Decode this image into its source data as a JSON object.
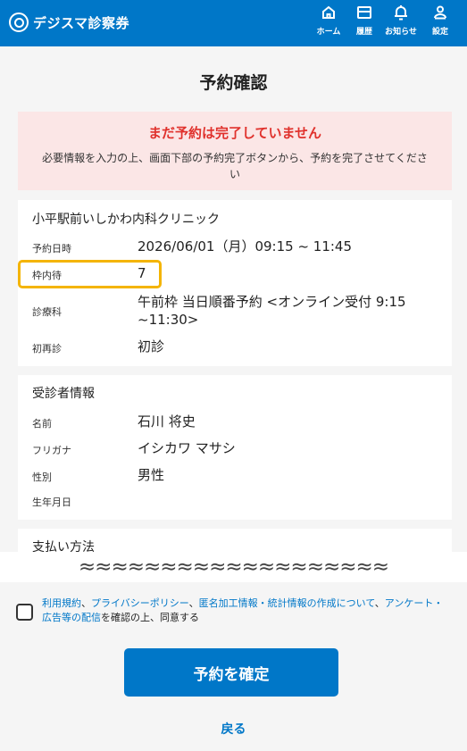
{
  "header": {
    "logo_text": "デジスマ診察券",
    "nav": [
      {
        "label": "ホーム",
        "icon": "home-icon"
      },
      {
        "label": "履歴",
        "icon": "card-icon"
      },
      {
        "label": "お知らせ",
        "icon": "bell-icon"
      },
      {
        "label": "設定",
        "icon": "user-icon"
      }
    ]
  },
  "page_title": "予約確認",
  "alert": {
    "title": "まだ予約は完了していません",
    "body": "必要情報を入力の上、画面下部の予約完了ボタンから、予約を完了させてください"
  },
  "reservation": {
    "clinic": "小平駅前いしかわ内科クリニック",
    "rows": [
      {
        "label": "予約日時",
        "value": "2026/06/01（月）09:15 ~ 11:45"
      },
      {
        "label": "枠内待",
        "value": "7"
      },
      {
        "label": "診療科",
        "value": "午前枠 当日順番予約 <オンライン受付 9:15 ~11:30>"
      },
      {
        "label": "初再診",
        "value": "初診"
      }
    ]
  },
  "patient": {
    "title": "受診者情報",
    "rows": [
      {
        "label": "名前",
        "value": "石川 将史"
      },
      {
        "label": "フリガナ",
        "value": "イシカワ マサシ"
      },
      {
        "label": "性別",
        "value": "男性"
      },
      {
        "label": "生年月日",
        "value": ""
      }
    ]
  },
  "payment": {
    "title": "支払い方法"
  },
  "cut_marker": "≈≈≈≈≈≈≈≈≈≈≈≈≈≈≈≈≈≈≈",
  "consent": {
    "links": [
      "利用規約",
      "プライバシーポリシー",
      "匿名加工情報・統計情報の作成について",
      "アンケート・広告等の配信"
    ],
    "sep": "、",
    "suffix": "を確認の上、同意する"
  },
  "confirm_button": "予約を確定",
  "back_link": "戻る",
  "colors": {
    "primary": "#0077c8",
    "alert_bg": "#fbe6e6",
    "alert_text": "#e0312c",
    "highlight": "#f4b400"
  }
}
